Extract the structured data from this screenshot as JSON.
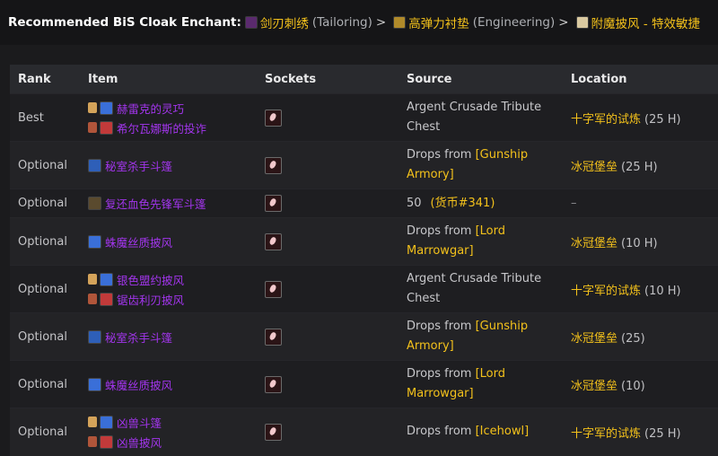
{
  "header": {
    "label": "Recommended BiS Cloak Enchant:",
    "crumbs": [
      {
        "name": "剑刃刺绣",
        "profession": "(Tailoring)"
      },
      {
        "name": "高弹力衬垫",
        "profession": "(Engineering)"
      },
      {
        "name": "附魔披风 - 特效敏捷",
        "profession": ""
      }
    ],
    "separator": ">"
  },
  "table": {
    "columns": [
      "Rank",
      "Item",
      "Sockets",
      "Source",
      "Location"
    ],
    "rows": [
      {
        "rank": "Best",
        "items": [
          {
            "name": "赫雷克的灵巧",
            "slot_color": "#d4a35a",
            "icon_color": "#3a6fd8"
          },
          {
            "name": "希尔瓦娜斯的投诈",
            "slot_color": "#b0553a",
            "icon_color": "#c23a3a"
          }
        ],
        "source_pre": "Argent Crusade Tribute Chest",
        "source_link": "",
        "source_post": "",
        "location": "十字军的试炼",
        "location_suffix": "(25 H)"
      },
      {
        "rank": "Optional",
        "items": [
          {
            "name": "秘室杀手斗篷",
            "slot_color": "",
            "icon_color": "#2e5fb8"
          }
        ],
        "source_pre": "Drops from ",
        "source_link": "[Gunship Armory]",
        "source_post": "",
        "location": "冰冠堡垒",
        "location_suffix": "(25 H)"
      },
      {
        "rank": "Optional",
        "items": [
          {
            "name": "复还血色先锋军斗篷",
            "slot_color": "",
            "icon_color": "#5a4a2e"
          }
        ],
        "source_pre": "50",
        "source_link": "",
        "source_post": "(货币#341)",
        "location": "",
        "location_suffix": "–"
      },
      {
        "rank": "Optional",
        "items": [
          {
            "name": "蛛魔丝质披风",
            "slot_color": "",
            "icon_color": "#3a6fd8"
          }
        ],
        "source_pre": "Drops from ",
        "source_link": "[Lord Marrowgar]",
        "source_post": "",
        "location": "冰冠堡垒",
        "location_suffix": "(10 H)"
      },
      {
        "rank": "Optional",
        "items": [
          {
            "name": "银色盟约披风",
            "slot_color": "#d4a35a",
            "icon_color": "#3a6fd8"
          },
          {
            "name": "锯齿利刃披风",
            "slot_color": "#b0553a",
            "icon_color": "#c23a3a"
          }
        ],
        "source_pre": "Argent Crusade Tribute Chest",
        "source_link": "",
        "source_post": "",
        "location": "十字军的试炼",
        "location_suffix": "(10 H)"
      },
      {
        "rank": "Optional",
        "items": [
          {
            "name": "秘室杀手斗篷",
            "slot_color": "",
            "icon_color": "#2e5fb8"
          }
        ],
        "source_pre": "Drops from ",
        "source_link": "[Gunship Armory]",
        "source_post": "",
        "location": "冰冠堡垒",
        "location_suffix": "(25)"
      },
      {
        "rank": "Optional",
        "items": [
          {
            "name": "蛛魔丝质披风",
            "slot_color": "",
            "icon_color": "#3a6fd8"
          }
        ],
        "source_pre": "Drops from ",
        "source_link": "[Lord Marrowgar]",
        "source_post": "",
        "location": "冰冠堡垒",
        "location_suffix": "(10)"
      },
      {
        "rank": "Optional",
        "items": [
          {
            "name": "凶兽斗篷",
            "slot_color": "#d4a35a",
            "icon_color": "#3a6fd8"
          },
          {
            "name": "凶兽披风",
            "slot_color": "#b0553a",
            "icon_color": "#c23a3a"
          }
        ],
        "source_pre": "Drops from ",
        "source_link": "[Icehowl]",
        "source_post": "",
        "location": "十字军的试炼",
        "location_suffix": "(25 H)"
      }
    ]
  },
  "colors": {
    "link_yellow": "#f3c11b",
    "epic_purple": "#a335ee",
    "header_bg": "#292a2e"
  },
  "icons": {
    "socket": "prismatic-socket-icon",
    "slot": "armor-slot-icon",
    "item": "cloak-item-icon"
  }
}
